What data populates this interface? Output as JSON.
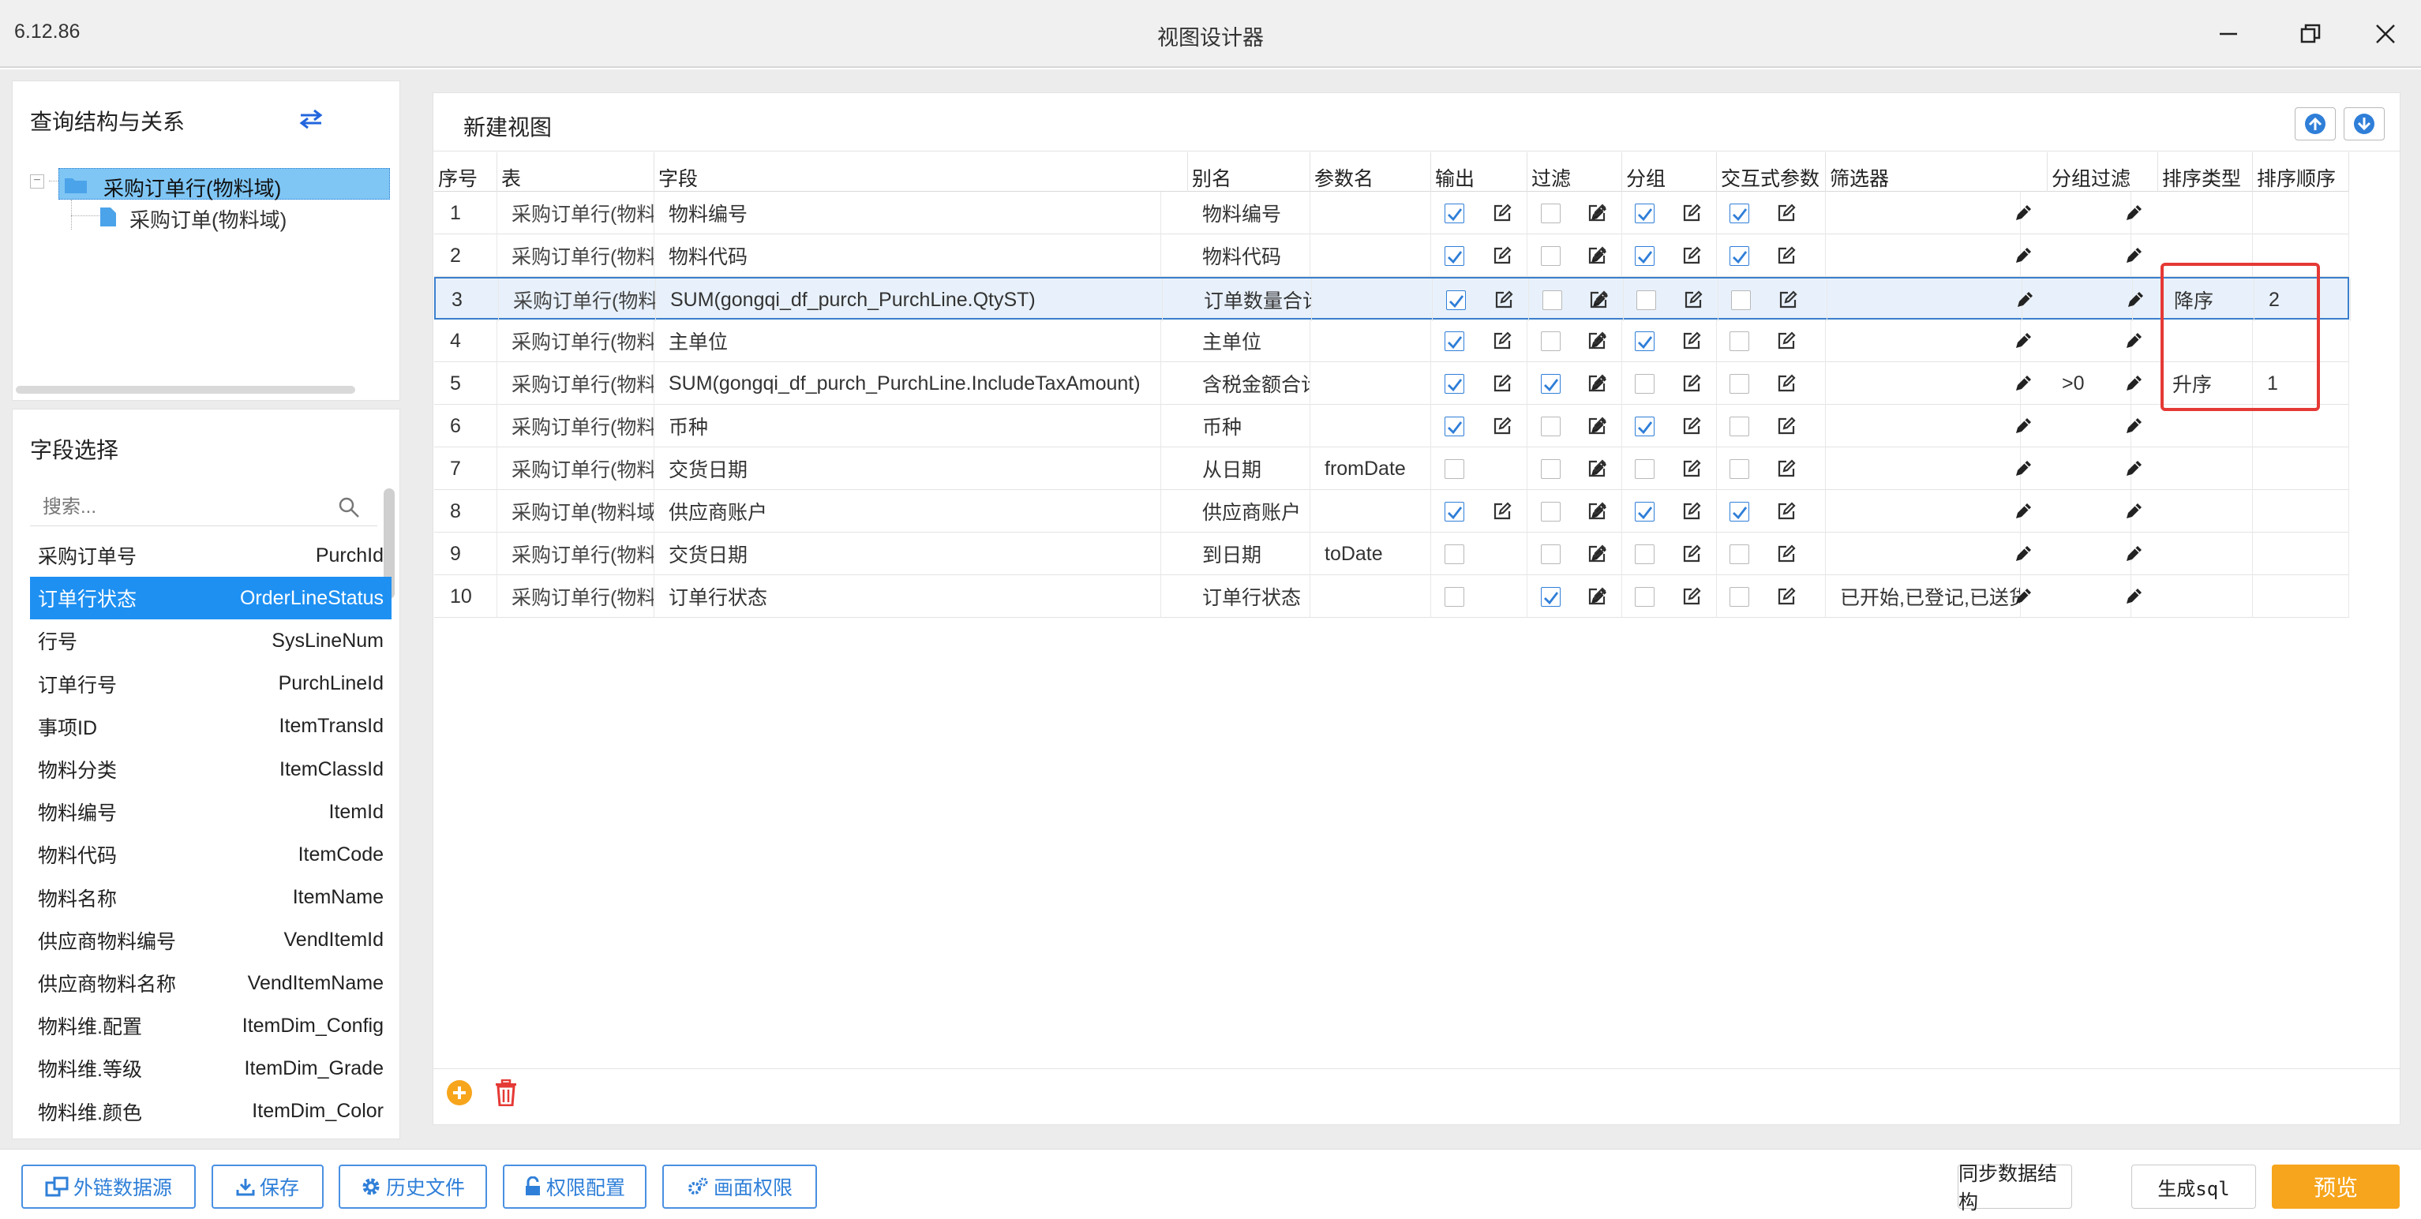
{
  "window": {
    "version": "6.12.86",
    "title": "视图设计器"
  },
  "query_panel": {
    "title": "查询结构与关系",
    "tree_root": "采购订单行(物料域)",
    "tree_child": "采购订单(物料域)"
  },
  "field_panel": {
    "title": "字段选择",
    "search_placeholder": "搜索...",
    "fields": [
      {
        "label": "采购订单号",
        "name": "PurchId",
        "selected": false
      },
      {
        "label": "订单行状态",
        "name": "OrderLineStatus",
        "selected": true
      },
      {
        "label": "行号",
        "name": "SysLineNum",
        "selected": false
      },
      {
        "label": "订单行号",
        "name": "PurchLineId",
        "selected": false
      },
      {
        "label": "事项ID",
        "name": "ItemTransId",
        "selected": false
      },
      {
        "label": "物料分类",
        "name": "ItemClassId",
        "selected": false
      },
      {
        "label": "物料编号",
        "name": "ItemId",
        "selected": false
      },
      {
        "label": "物料代码",
        "name": "ItemCode",
        "selected": false
      },
      {
        "label": "物料名称",
        "name": "ItemName",
        "selected": false
      },
      {
        "label": "供应商物料编号",
        "name": "VendItemId",
        "selected": false
      },
      {
        "label": "供应商物料名称",
        "name": "VendItemName",
        "selected": false
      },
      {
        "label": "物料维.配置",
        "name": "ItemDim_Config",
        "selected": false
      },
      {
        "label": "物料维.等级",
        "name": "ItemDim_Grade",
        "selected": false
      },
      {
        "label": "物料维.颜色",
        "name": "ItemDim_Color",
        "selected": false
      }
    ]
  },
  "view": {
    "title": "新建视图",
    "columns": [
      "序号",
      "表",
      "字段",
      "别名",
      "参数名",
      "输出",
      "过滤",
      "分组",
      "交互式参数",
      "筛选器",
      "分组过滤",
      "排序类型",
      "排序顺序"
    ],
    "rows": [
      {
        "no": "1",
        "table": "采购订单行(物料域)",
        "field": "物料编号",
        "alias": "物料编号",
        "param": "",
        "output": true,
        "filter": false,
        "group": true,
        "interactive": true,
        "filter_value": "",
        "group_filter": "",
        "sort_type": "",
        "sort_order": ""
      },
      {
        "no": "2",
        "table": "采购订单行(物料域)",
        "field": "物料代码",
        "alias": "物料代码",
        "param": "",
        "output": true,
        "filter": false,
        "group": true,
        "interactive": true,
        "filter_value": "",
        "group_filter": "",
        "sort_type": "",
        "sort_order": ""
      },
      {
        "no": "3",
        "table": "采购订单行(物料域)",
        "field": "SUM(gongqi_df_purch_PurchLine.QtyST)",
        "alias": "订单数量合计",
        "param": "",
        "output": true,
        "filter": false,
        "group": false,
        "interactive": false,
        "filter_value": "",
        "group_filter": "",
        "sort_type": "降序",
        "sort_order": "2"
      },
      {
        "no": "4",
        "table": "采购订单行(物料域)",
        "field": "主单位",
        "alias": "主单位",
        "param": "",
        "output": true,
        "filter": false,
        "group": true,
        "interactive": false,
        "filter_value": "",
        "group_filter": "",
        "sort_type": "",
        "sort_order": ""
      },
      {
        "no": "5",
        "table": "采购订单行(物料域)",
        "field": "SUM(gongqi_df_purch_PurchLine.IncludeTaxAmount)",
        "alias": "含税金额合计",
        "param": "",
        "output": true,
        "filter": true,
        "group": false,
        "interactive": false,
        "filter_value": "",
        "group_filter": ">0",
        "sort_type": "升序",
        "sort_order": "1"
      },
      {
        "no": "6",
        "table": "采购订单行(物料域)",
        "field": "币种",
        "alias": "币种",
        "param": "",
        "output": true,
        "filter": false,
        "group": true,
        "interactive": false,
        "filter_value": "",
        "group_filter": "",
        "sort_type": "",
        "sort_order": ""
      },
      {
        "no": "7",
        "table": "采购订单行(物料域)",
        "field": "交货日期",
        "alias": "从日期",
        "param": "fromDate",
        "output": false,
        "filter": false,
        "group": false,
        "interactive": false,
        "filter_value": "",
        "group_filter": "",
        "sort_type": "",
        "sort_order": ""
      },
      {
        "no": "8",
        "table": "采购订单(物料域)",
        "field": "供应商账户",
        "alias": "供应商账户",
        "param": "",
        "output": true,
        "filter": false,
        "group": true,
        "interactive": true,
        "filter_value": "",
        "group_filter": "",
        "sort_type": "",
        "sort_order": ""
      },
      {
        "no": "9",
        "table": "采购订单行(物料域)",
        "field": "交货日期",
        "alias": "到日期",
        "param": "toDate",
        "output": false,
        "filter": false,
        "group": false,
        "interactive": false,
        "filter_value": "",
        "group_filter": "",
        "sort_type": "",
        "sort_order": ""
      },
      {
        "no": "10",
        "table": "采购订单行(物料域)",
        "field": "订单行状态",
        "alias": "订单行状态",
        "param": "",
        "output": false,
        "filter": true,
        "group": false,
        "interactive": false,
        "filter_value": "已开始,已登记,已送货",
        "group_filter": "",
        "sort_type": "",
        "sort_order": ""
      }
    ],
    "selected_row": 2
  },
  "toolbar": {
    "external_source": "外链数据源",
    "save": "保存",
    "history": "历史文件",
    "permissions": "权限配置",
    "screen_permissions": "画面权限",
    "sync": "同步数据结构",
    "gen_sql": "生成sql",
    "preview": "预览"
  },
  "colors": {
    "accent": "#1e90f2",
    "preview": "#f7a51c",
    "highlight_box": "#e53935",
    "check": "#2f7ed8"
  }
}
